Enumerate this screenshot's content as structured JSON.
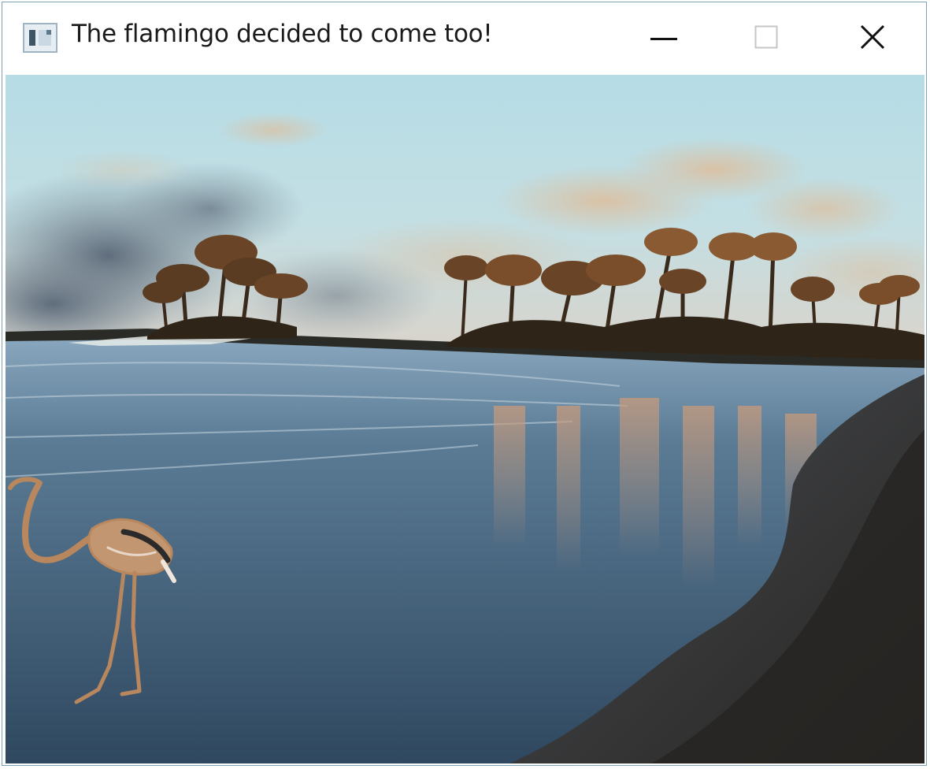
{
  "window": {
    "title": "The flamingo decided to come too!",
    "icon": "app-window-icon"
  },
  "controls": {
    "minimize_icon": "minimize-icon",
    "maximize_icon": "maximize-icon",
    "close_icon": "close-icon"
  },
  "scene": {
    "content": "beach-photo-with-flamingo-sprite"
  },
  "colors": {
    "titlebar": "#ffffff",
    "border": "#7da2b8",
    "sky": "#b7dde6",
    "water": "#3e5a76",
    "sand": "#2b2a28",
    "flamingo": "#b8875e"
  }
}
